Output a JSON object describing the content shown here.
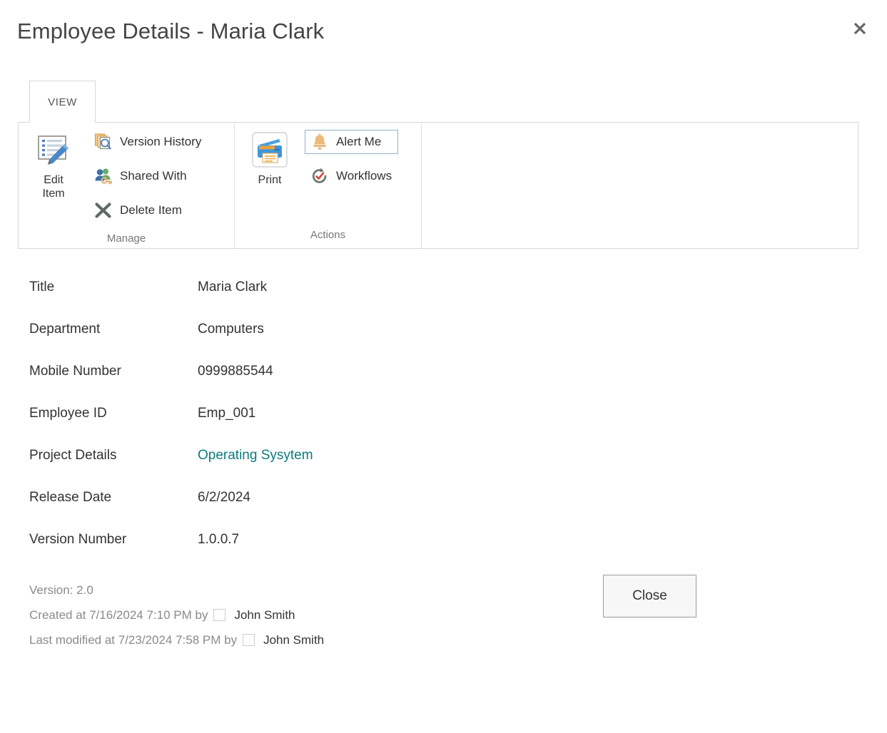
{
  "dialog": {
    "title": "Employee Details - Maria Clark",
    "close_icon": "close-x-icon",
    "close_button_label": "Close"
  },
  "ribbon": {
    "tabs": [
      {
        "label": "VIEW",
        "active": true
      }
    ],
    "groups": [
      {
        "name": "Manage",
        "label": "Manage",
        "big_button": {
          "label_line1": "Edit",
          "label_line2": "Item",
          "icon": "edit-item-icon"
        },
        "small_buttons": [
          {
            "label": "Version History",
            "icon": "version-history-icon",
            "highlight": false
          },
          {
            "label": "Shared With",
            "icon": "shared-with-icon",
            "highlight": false
          },
          {
            "label": "Delete Item",
            "icon": "delete-item-icon",
            "highlight": false
          }
        ]
      },
      {
        "name": "Actions",
        "label": "Actions",
        "big_button": {
          "label_line1": "Print",
          "label_line2": "",
          "icon": "print-icon"
        },
        "small_buttons": [
          {
            "label": "Alert Me",
            "icon": "alert-me-bell-icon",
            "highlight": true
          },
          {
            "label": "Workflows",
            "icon": "workflows-icon",
            "highlight": false
          }
        ]
      }
    ]
  },
  "fields": [
    {
      "label": "Title",
      "value": "Maria Clark",
      "is_link": false
    },
    {
      "label": "Department",
      "value": "Computers",
      "is_link": false
    },
    {
      "label": "Mobile Number",
      "value": "0999885544",
      "is_link": false
    },
    {
      "label": "Employee ID",
      "value": "Emp_001",
      "is_link": false
    },
    {
      "label": "Project Details",
      "value": "Operating Sysytem",
      "is_link": true
    },
    {
      "label": "Release Date",
      "value": "6/2/2024",
      "is_link": false
    },
    {
      "label": "Version Number",
      "value": "1.0.0.7",
      "is_link": false
    }
  ],
  "meta": {
    "version_line": "Version: 2.0",
    "created_prefix": "Created at 7/16/2024 7:10 PM  by",
    "created_user": "John Smith",
    "modified_prefix": "Last modified at 7/23/2024 7:58 PM  by",
    "modified_user": "John Smith"
  },
  "colors": {
    "link_teal": "#0c7b7c",
    "highlight_border": "#8cb3ce",
    "ribbon_border": "#d7d7d7",
    "meta_grey": "#8a8a8a",
    "text": "#333333"
  }
}
